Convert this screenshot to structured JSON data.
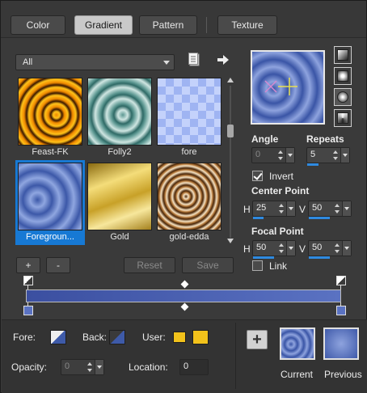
{
  "tabs": [
    {
      "label": "Color",
      "active": false
    },
    {
      "label": "Gradient",
      "active": true
    },
    {
      "label": "Pattern",
      "active": false
    },
    {
      "label": "Texture",
      "active": false
    }
  ],
  "category": {
    "selected": "All"
  },
  "gradients": [
    {
      "name": "Feast-FK",
      "selected": false
    },
    {
      "name": "Folly2",
      "selected": false
    },
    {
      "name": "fore",
      "selected": false
    },
    {
      "name": "Foregroun...",
      "selected": true
    },
    {
      "name": "Gold",
      "selected": false
    },
    {
      "name": "gold-edda",
      "selected": false
    }
  ],
  "list_buttons": {
    "add": "+",
    "remove": "-",
    "reset": "Reset",
    "save": "Save"
  },
  "angle": {
    "label": "Angle",
    "value": "0"
  },
  "repeats": {
    "label": "Repeats",
    "value": "5"
  },
  "invert": {
    "label": "Invert",
    "checked": true
  },
  "center_point": {
    "label": "Center Point",
    "h_label": "H",
    "h": "25",
    "v_label": "V",
    "v": "50"
  },
  "focal_point": {
    "label": "Focal Point",
    "h_label": "H",
    "h": "50",
    "v_label": "V",
    "v": "50"
  },
  "link": {
    "label": "Link",
    "checked": false
  },
  "bottom": {
    "fore_label": "Fore:",
    "back_label": "Back:",
    "user_label": "User:",
    "opacity_label": "Opacity:",
    "opacity_value": "0",
    "location_label": "Location:",
    "location_value": "0",
    "current_label": "Current",
    "previous_label": "Previous"
  },
  "colors": {
    "accent": "#1779d4",
    "gradient_start": "#3b4fa0",
    "gradient_end": "#5a72c2",
    "user_swatch": "#f2c21b"
  }
}
